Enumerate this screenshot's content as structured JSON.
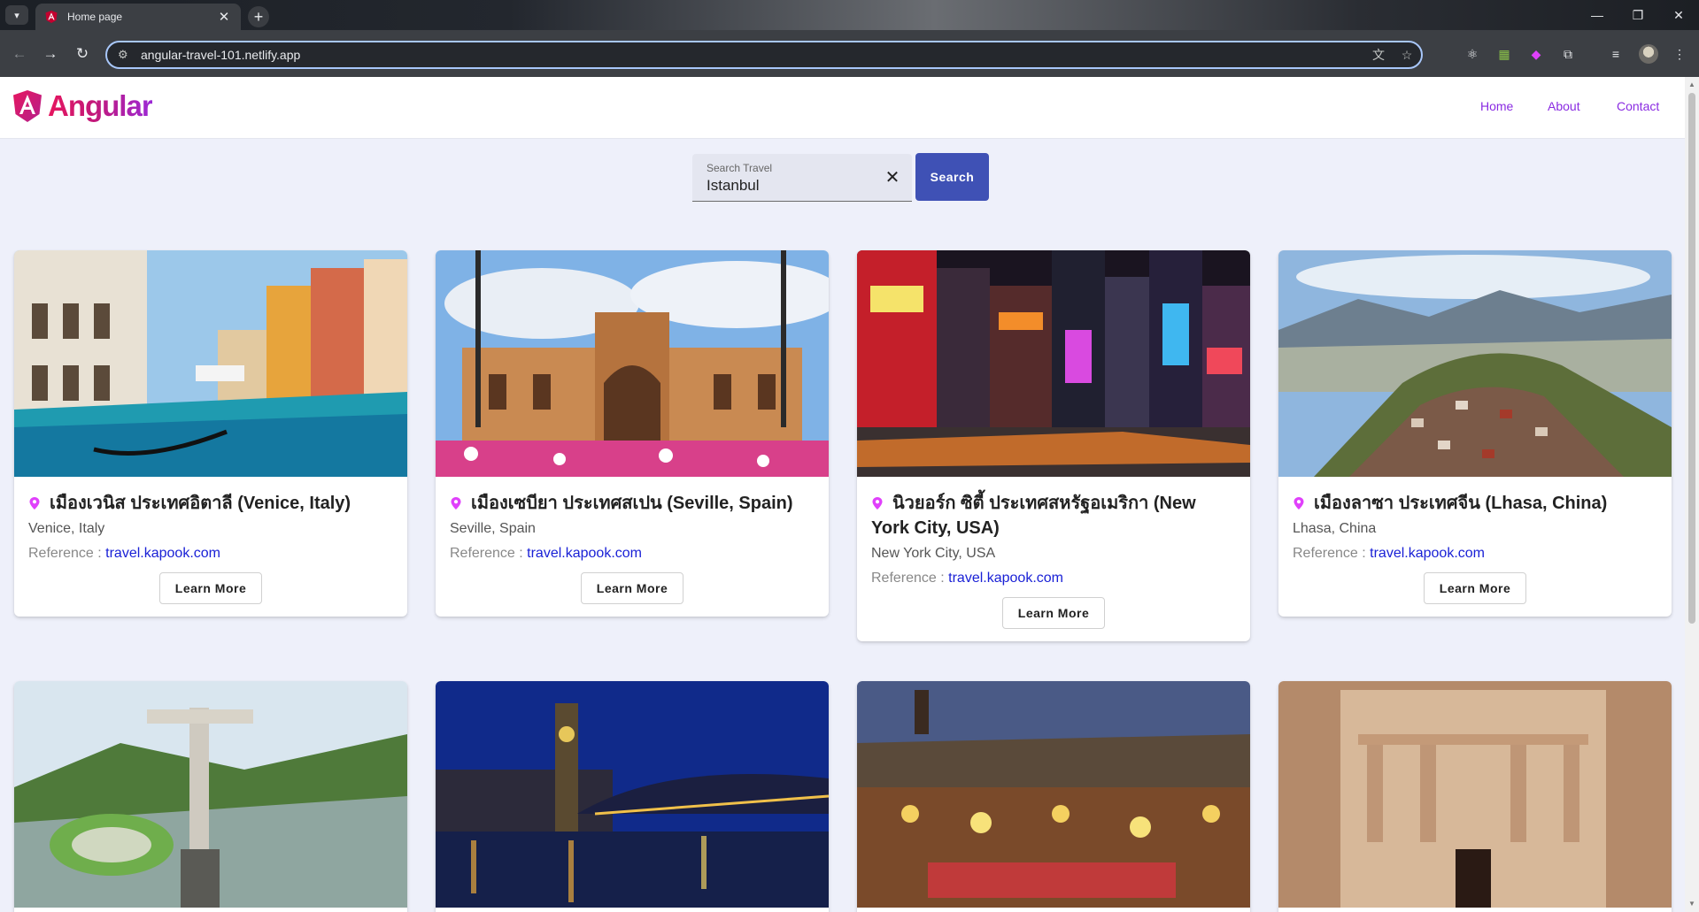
{
  "browser": {
    "tab_title": "Home page",
    "url": "angular-travel-101.netlify.app"
  },
  "header": {
    "logo_text": "Angular",
    "nav": [
      "Home",
      "About",
      "Contact"
    ]
  },
  "search": {
    "label": "Search Travel",
    "value": "Istanbul",
    "button_label": "Search"
  },
  "cards": [
    {
      "title": "เมืองเวนิส ประเทศอิตาลี (Venice, Italy)",
      "subtitle": "Venice, Italy",
      "ref_label": "Reference : ",
      "ref_link": "travel.kapook.com",
      "button": "Learn More"
    },
    {
      "title": "เมืองเซบียา ประเทศสเปน (Seville, Spain)",
      "subtitle": "Seville, Spain",
      "ref_label": "Reference : ",
      "ref_link": "travel.kapook.com",
      "button": "Learn More"
    },
    {
      "title": "นิวยอร์ก ซิตี้ ประเทศสหรัฐอเมริกา (New York City, USA)",
      "subtitle": "New York City, USA",
      "ref_label": "Reference : ",
      "ref_link": "travel.kapook.com",
      "button": "Learn More"
    },
    {
      "title": "เมืองลาซา ประเทศจีน (Lhasa, China)",
      "subtitle": "Lhasa, China",
      "ref_label": "Reference : ",
      "ref_link": "travel.kapook.com",
      "button": "Learn More"
    }
  ],
  "colors": {
    "accent": "#3f51b5",
    "nav_link": "#8a2be2",
    "pin": "#e040fb",
    "link": "#1a21d6"
  }
}
